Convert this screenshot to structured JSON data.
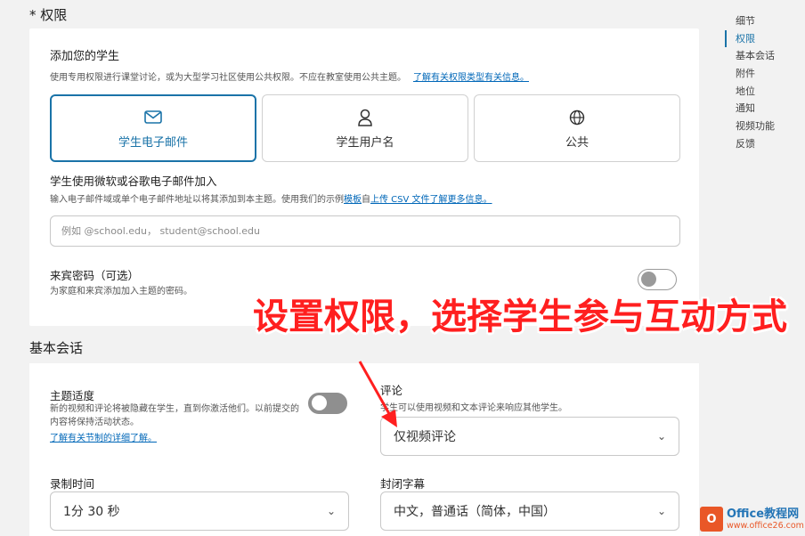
{
  "permissions": {
    "header": "* 权限",
    "add_title": "添加您的学生",
    "add_desc": "使用专用权限进行课堂讨论，或为大型学习社区使用公共权限。不应在教室使用公共主题。",
    "add_link": "了解有关权限类型有关信息。",
    "options": [
      {
        "label": "学生电子邮件",
        "icon": "envelope-icon",
        "selected": true
      },
      {
        "label": "学生用户名",
        "icon": "user-icon",
        "selected": false
      },
      {
        "label": "公共",
        "icon": "globe-icon",
        "selected": false
      }
    ],
    "join_title": "学生使用微软或谷歌电子邮件加入",
    "join_desc_prefix": "输入电子邮件域或单个电子邮件地址以将其添加到本主题。使用我们的示例",
    "join_template_link": "模板",
    "join_from": "自",
    "join_upload_link": "上传 CSV 文件",
    "join_more_link": "了解更多信息。",
    "email_placeholder": "例如 @school.edu， student@school.edu",
    "guest_title": "来宾密码（可选）",
    "guest_desc": "为家庭和来宾添加加入主题的密码。"
  },
  "basic": {
    "header": "基本会话",
    "topic_title": "主题适度",
    "topic_desc": "新的视频和评论将被隐藏在学生，直到你激活他们。以前提交的内容将保持活动状态。",
    "topic_link": "了解有关节制的详细了解。",
    "comment_title": "评论",
    "comment_desc": "学生可以使用视频和文本评论来响应其他学生。",
    "comment_value": "仅视频评论",
    "time_title": "录制时间",
    "time_value": "1分 30 秒",
    "caption_title": "封闭字幕",
    "caption_value": "中文，普通话（简体，中国）"
  },
  "side_nav": [
    {
      "label": "细节",
      "active": false
    },
    {
      "label": "权限",
      "active": true
    },
    {
      "label": "基本会话",
      "active": false
    },
    {
      "label": "附件",
      "active": false
    },
    {
      "label": "地位",
      "active": false
    },
    {
      "label": "通知",
      "active": false
    },
    {
      "label": "视频功能",
      "active": false
    },
    {
      "label": "反馈",
      "active": false
    }
  ],
  "annotation": {
    "text": "设置权限，选择学生参与互动方式",
    "color": "#ff1f1f"
  },
  "watermark": {
    "logo_char": "O",
    "name": "Office教程网",
    "url": "www.office26.com"
  },
  "colors": {
    "accent": "#1a73a8",
    "link": "#0067b8"
  }
}
